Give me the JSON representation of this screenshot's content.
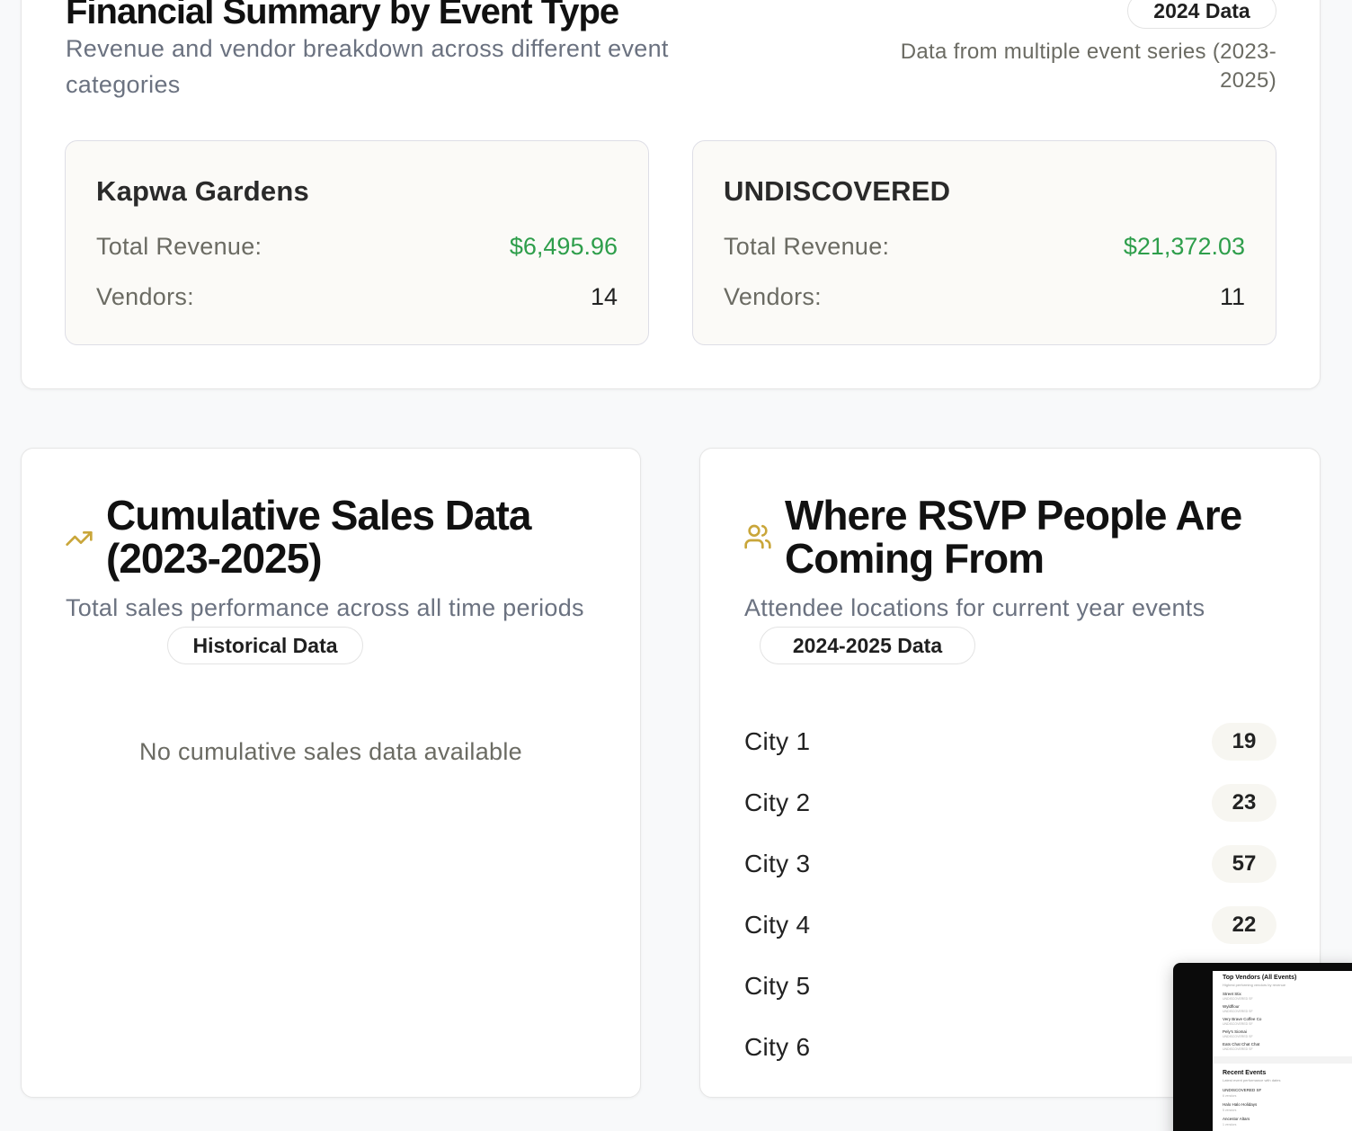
{
  "financial": {
    "title": "Financial Summary by Event Type",
    "subtitle": "Revenue and vendor breakdown across different event categories",
    "badge": "2024 Data",
    "note": "Data from multiple event series (2023-2025)",
    "events": [
      {
        "name": "Kapwa Gardens",
        "revenue_label": "Total Revenue:",
        "revenue": "$6,495.96",
        "vendors_label": "Vendors:",
        "vendors": "14"
      },
      {
        "name": "UNDISCOVERED",
        "revenue_label": "Total Revenue:",
        "revenue": "$21,372.03",
        "vendors_label": "Vendors:",
        "vendors": "11"
      }
    ]
  },
  "sales": {
    "icon": "trending-up-icon",
    "title": "Cumulative Sales Data (2023-2025)",
    "subtitle": "Total sales performance across all time periods",
    "badge": "Historical Data",
    "empty": "No cumulative sales data available"
  },
  "rsvp": {
    "icon": "users-icon",
    "title": "Where RSVP People Are Coming From",
    "subtitle": "Attendee locations for current year events",
    "badge": "2024-2025 Data",
    "cities": [
      {
        "name": "City 1",
        "count": "19"
      },
      {
        "name": "City 2",
        "count": "23"
      },
      {
        "name": "City 3",
        "count": "57"
      },
      {
        "name": "City 4",
        "count": "22"
      },
      {
        "name": "City 5",
        "count": ""
      },
      {
        "name": "City 6",
        "count": ""
      }
    ]
  },
  "thumbnail": {
    "vendors_title": "Top Vendors (All Events)",
    "vendors_sub": "Highest performing vendors by revenue",
    "vendors": [
      {
        "name": "Street Stix",
        "detail": "UNDISCOVERED SF"
      },
      {
        "name": "Wyldflour",
        "detail": "UNDISCOVERED SF"
      },
      {
        "name": "Very Brave Coffee Co",
        "detail": "UNDISCOVERED SF"
      },
      {
        "name": "Pely's Siomai",
        "detail": "UNDISCOVERED SF"
      },
      {
        "name": "Eats Chat Chat Chat",
        "detail": "UNDISCOVERED SF"
      }
    ],
    "events_title": "Recent Events",
    "events_sub": "Latest event performance with dates",
    "events": [
      {
        "name": "UNDISCOVERED SF",
        "detail": "6 vendors"
      },
      {
        "name": "Halo Halo Holidays",
        "detail": "5 vendors"
      },
      {
        "name": "Ancestor Altars",
        "detail": "1 vendors"
      }
    ]
  },
  "colors": {
    "accent_icon": "#c9a63a",
    "revenue": "#2e9e4b"
  }
}
